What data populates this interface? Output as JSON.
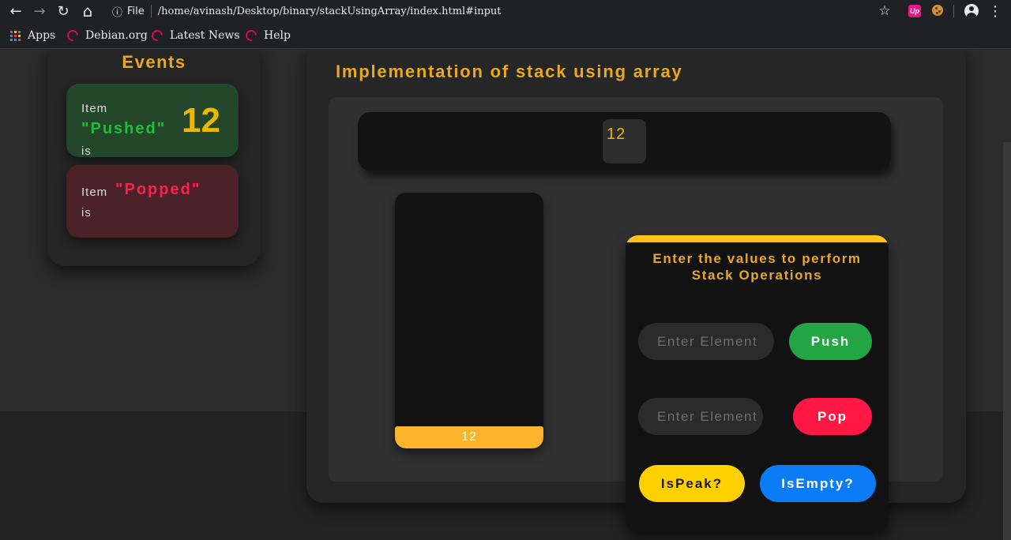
{
  "browser": {
    "nav_back": "←",
    "nav_forward": "→",
    "nav_reload": "↻",
    "nav_home": "⌂",
    "info_icon": "ⓘ",
    "file_label": "File",
    "url": "/home/avinash/Desktop/binary/stackUsingArray/index.html#input",
    "star": "☆",
    "extension_up": "Up",
    "menu": "⋮"
  },
  "bookmarks": [
    {
      "label": "Apps",
      "icon": "apps-grid-icon"
    },
    {
      "label": "Debian.org",
      "icon": "debian-swirl-icon"
    },
    {
      "label": "Latest News",
      "icon": "debian-swirl-icon"
    },
    {
      "label": "Help",
      "icon": "debian-swirl-icon"
    }
  ],
  "events": {
    "title": "Events",
    "push_card": {
      "item_label": "Item",
      "state": "\"Pushed\"",
      "is_label": "is",
      "value": "12"
    },
    "pop_card": {
      "item_label": "Item",
      "state": "\"Popped\"",
      "is_label": "is"
    }
  },
  "main": {
    "title": "Implementation of stack using array",
    "array": [
      "12"
    ],
    "stack": [
      "12"
    ]
  },
  "operations": {
    "title_line1": "Enter the values to perform",
    "title_line2": "Stack Operations",
    "push_placeholder": "Enter Element",
    "pop_placeholder": "Enter Element",
    "push_label": "Push",
    "pop_label": "Pop",
    "peak_label": "IsPeak?",
    "empty_label": "IsEmpty?"
  },
  "colors": {
    "accent": "#e9a81e",
    "push_green": "#23a544",
    "pop_red": "#ff1844",
    "peak_yellow": "#ffd000",
    "empty_blue": "#0b7cf6",
    "stack_item": "#fbb42c"
  }
}
